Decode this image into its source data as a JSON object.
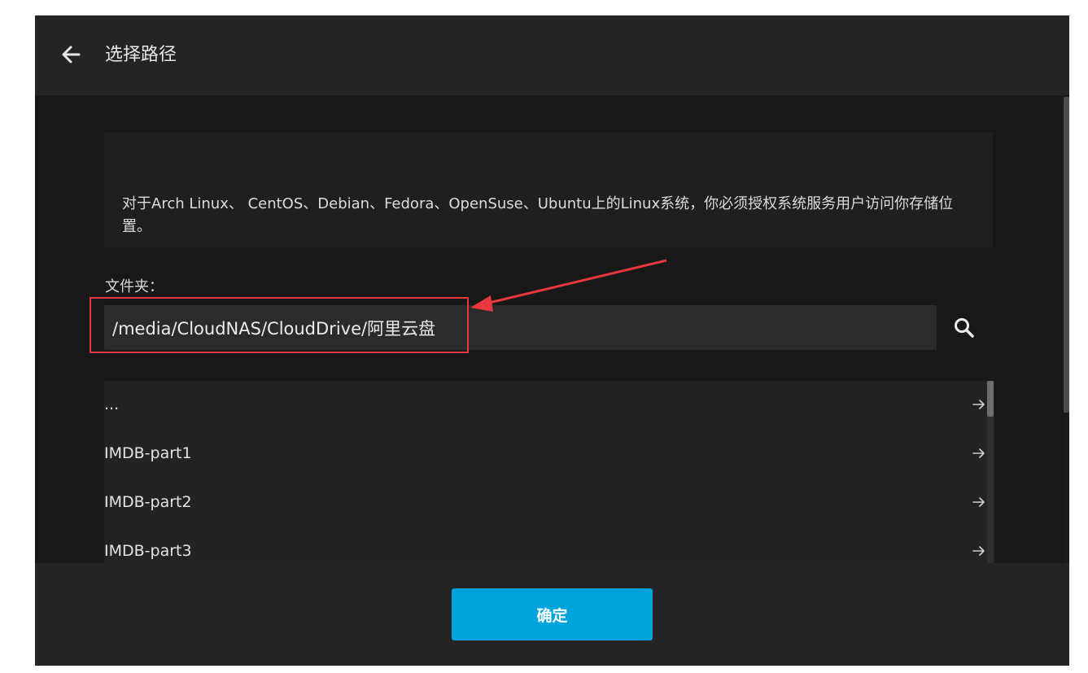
{
  "header": {
    "back_icon": "arrow-left-icon",
    "title": "选择路径"
  },
  "info": {
    "text": "对于Arch Linux、 CentOS、Debian、Fedora、OpenSuse、Ubuntu上的Linux系统，你必须授权系统服务用户访问你存储位置。"
  },
  "folder": {
    "label": "文件夹：",
    "value": "/media/CloudNAS/CloudDrive/阿里云盘",
    "search_icon": "search-icon"
  },
  "list": {
    "items": [
      {
        "label": "...",
        "icon": "arrow-right-icon"
      },
      {
        "label": "IMDB-part1",
        "icon": "arrow-right-icon"
      },
      {
        "label": "IMDB-part2",
        "icon": "arrow-right-icon"
      },
      {
        "label": "IMDB-part3",
        "icon": "arrow-right-icon"
      }
    ]
  },
  "footer": {
    "ok_label": "确定"
  },
  "colors": {
    "dialog_bg": "#181818",
    "bar_bg": "#242424",
    "accent": "#00a4dc",
    "annotation": "#e8373d"
  }
}
